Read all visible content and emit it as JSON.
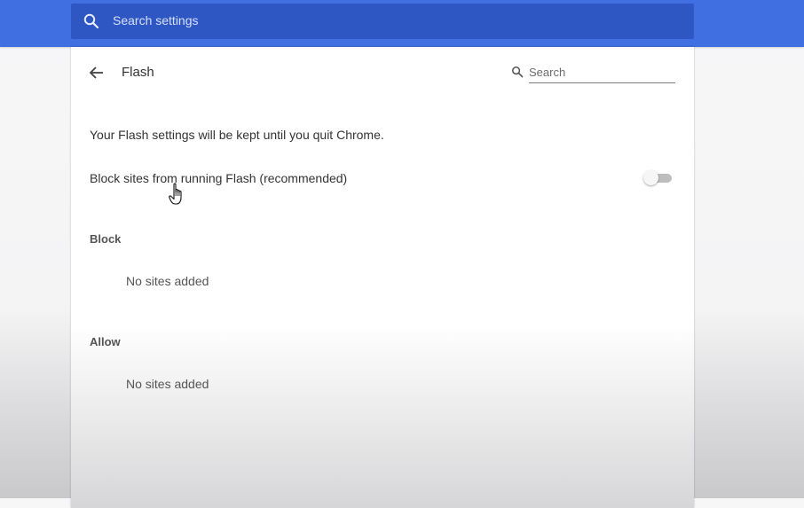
{
  "header": {
    "search_placeholder": "Search settings"
  },
  "page": {
    "title": "Flash",
    "search_placeholder": "Search"
  },
  "content": {
    "info_text": "Your Flash settings will be kept until you quit Chrome.",
    "toggle_label": "Block sites from running Flash (recommended)",
    "toggle_on": false,
    "block": {
      "heading": "Block",
      "empty_text": "No sites added"
    },
    "allow": {
      "heading": "Allow",
      "empty_text": "No sites added"
    }
  },
  "icons": {
    "header_search": "search-icon",
    "back": "arrow-back-icon",
    "sub_search": "search-icon",
    "cursor": "hand-pointer-icon"
  },
  "colors": {
    "header_bar": "#3f6fe0",
    "header_search_box": "#2f57c4"
  }
}
